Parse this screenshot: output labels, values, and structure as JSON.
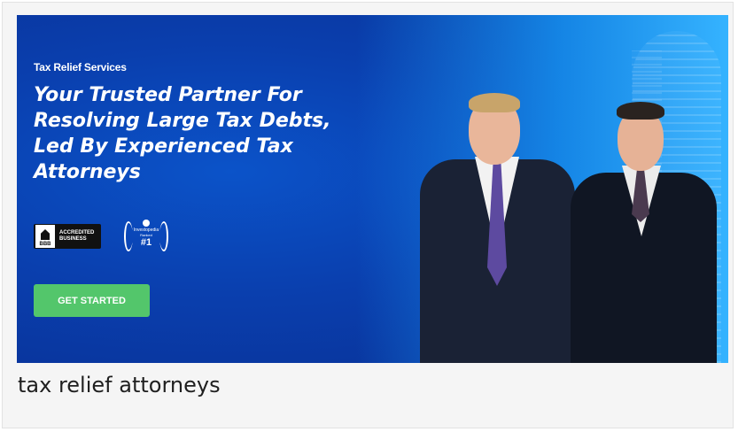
{
  "banner": {
    "eyebrow": "Tax Relief Services",
    "headline": "Your Trusted Partner For Resolving Large Tax Debts, Led By Experienced Tax Attorneys",
    "bbb_badge": {
      "logo_text": "BBB",
      "line1": "ACCREDITED",
      "line2": "BUSINESS"
    },
    "ranking_badge": {
      "brand": "Investopedia",
      "rank_label": "Ranked",
      "rank": "#1"
    },
    "cta_label": "GET STARTED",
    "colors": {
      "background": "#0a3fae",
      "cta": "#53c66b",
      "accent_right": "#35b3ff"
    }
  },
  "caption": "tax relief attorneys"
}
